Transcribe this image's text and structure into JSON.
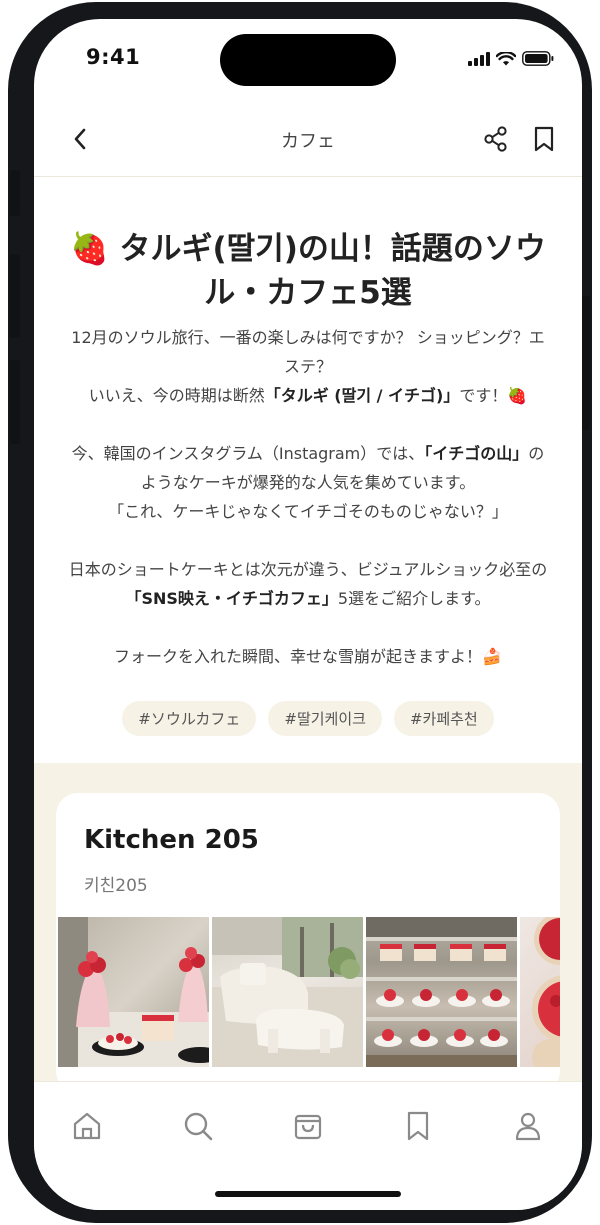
{
  "status_bar": {
    "time": "9:41"
  },
  "header": {
    "title": "カフェ"
  },
  "article": {
    "title": "🍓 タルギ(딸기)の山！話題のソウル・カフェ5選",
    "paragraphs": [
      [
        "12月のソウル旅行、一番の楽しみは何ですか？ ショッピング？エステ？"
      ],
      [
        "いいえ、今の時期は断然",
        "「タルギ (딸기 / イチゴ)」",
        "です！🍓"
      ],
      [
        "今、韓国のインスタグラム（Instagram）では、",
        "「イチゴの山」",
        "のようなケーキが爆発的な人気を集めています。"
      ],
      [
        "「これ、ケーキじゃなくてイチゴそのものじゃない？」"
      ],
      [
        "日本のショートケーキとは次元が違う、ビジュアルショック必至の",
        "「SNS映え・イチゴカフェ」",
        "5選をご紹介します。"
      ],
      [
        "フォークを入れた瞬間、幸せな雪崩が起きますよ！🍰"
      ]
    ],
    "tags": [
      "#ソウルカフェ",
      "#딸기케이크",
      "#카페추천"
    ]
  },
  "cafe_card": {
    "name": "Kitchen 205",
    "subname": "키친205",
    "photos": [
      "strawberry-parfait-photo",
      "cafe-interior-photo",
      "cake-showcase-photo",
      "strawberry-tart-photo"
    ]
  },
  "tab_bar": {
    "items": [
      "home-icon",
      "search-icon",
      "shopping-bag-icon",
      "bookmark-icon",
      "profile-icon"
    ]
  },
  "colors": {
    "accent_bg": "#f6f2e6",
    "text_primary": "#222222",
    "text_secondary": "#444444",
    "strawberry": "#d9303e"
  }
}
